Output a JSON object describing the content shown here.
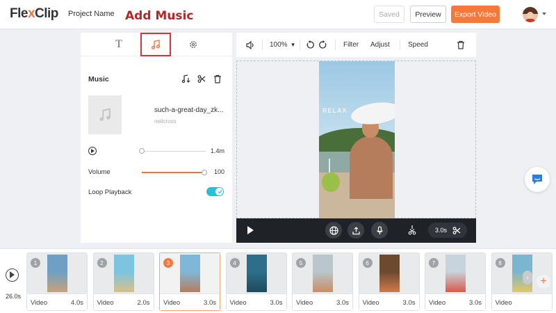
{
  "app": {
    "logo": "FlexClip",
    "logo_accent_letter": "X",
    "project_name": "Project Name",
    "annotation": "Add Music",
    "saved_label": "Saved",
    "preview_label": "Preview",
    "export_label": "Export Video",
    "accent_color": "#f5793b"
  },
  "left_panel": {
    "tabs": [
      {
        "name": "text",
        "icon": "text-icon"
      },
      {
        "name": "music",
        "icon": "music-note-icon",
        "active": true
      },
      {
        "name": "settings",
        "icon": "gear-icon"
      }
    ],
    "section_title": "Music",
    "track": {
      "name": "such-a-great-day_zk...",
      "artist": "neilcross",
      "duration": "1.4m",
      "progress": 0.0
    },
    "volume_label": "Volume",
    "volume_value": "100",
    "volume_level": 1.0,
    "loop_label": "Loop Playback",
    "loop_enabled": true
  },
  "toolbar": {
    "zoom": "100%",
    "filter_label": "Filter",
    "adjust_label": "Adjust",
    "speed_label": "Speed"
  },
  "preview": {
    "overlay_text": "RELAX",
    "duration": "3.0s"
  },
  "timeline": {
    "total_duration": "26.0s",
    "clips": [
      {
        "num": "1",
        "type": "Video",
        "duration": "4.0s",
        "selected": false
      },
      {
        "num": "2",
        "type": "Video",
        "duration": "2.0s",
        "selected": false
      },
      {
        "num": "3",
        "type": "Video",
        "duration": "3.0s",
        "selected": true
      },
      {
        "num": "4",
        "type": "Video",
        "duration": "3.0s",
        "selected": false
      },
      {
        "num": "5",
        "type": "Video",
        "duration": "3.0s",
        "selected": false
      },
      {
        "num": "6",
        "type": "Video",
        "duration": "3.0s",
        "selected": false
      },
      {
        "num": "7",
        "type": "Video",
        "duration": "3.0s",
        "selected": false
      },
      {
        "num": "8",
        "type": "Video",
        "duration": "",
        "selected": false
      }
    ]
  }
}
